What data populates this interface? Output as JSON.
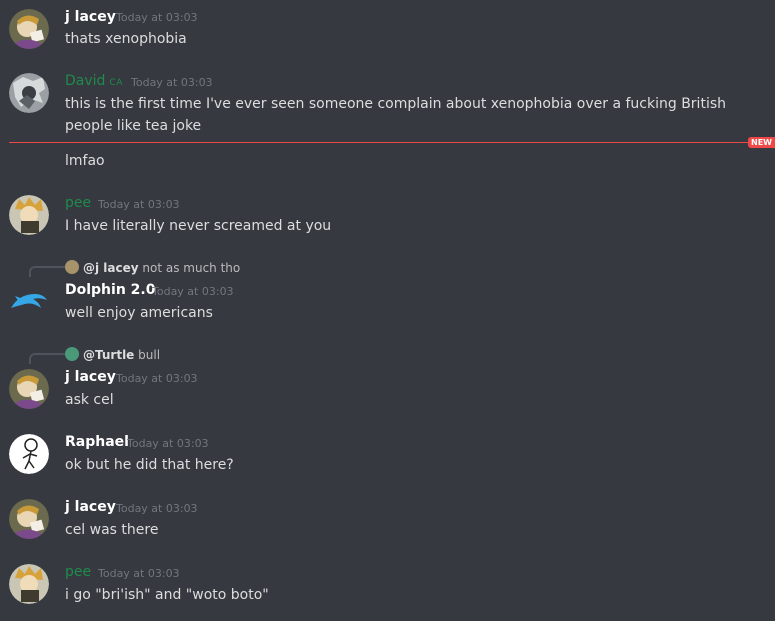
{
  "messages": [
    {
      "author": "j lacey",
      "time": "Today at 03:03",
      "text": "thats xenophobia"
    },
    {
      "author": "David",
      "tag": "CA",
      "time": "Today at 03:03",
      "text": "this is the first time I've ever seen someone complain about xenophobia over a fucking British people like tea joke"
    },
    {
      "text": "lmfao"
    },
    {
      "author": "pee",
      "time": "Today at 03:03",
      "text": "I have literally never screamed at you"
    },
    {
      "reply": {
        "mention": "@j lacey",
        "text": "not as much tho"
      },
      "author": "Dolphin 2.0",
      "time": "Today at 03:03",
      "text": "well enjoy americans"
    },
    {
      "reply": {
        "mention": "@Turtle",
        "text": "bull"
      },
      "author": "j lacey",
      "time": "Today at 03:03",
      "text": "ask cel"
    },
    {
      "author": "Raphael",
      "time": "Today at 03:03",
      "text": "ok but he did that here?"
    },
    {
      "author": "j lacey",
      "time": "Today at 03:03",
      "text": "cel was there"
    },
    {
      "author": "pee",
      "time": "Today at 03:03",
      "text": "i go \"bri'ish\" and \"woto boto\""
    }
  ],
  "divider": {
    "label": "NEW"
  },
  "colors": {
    "background": "#36393f",
    "new_divider": "#f04747",
    "green_role": "#1f8b4c"
  },
  "icons": {
    "dolphin": "dolphin-icon"
  }
}
